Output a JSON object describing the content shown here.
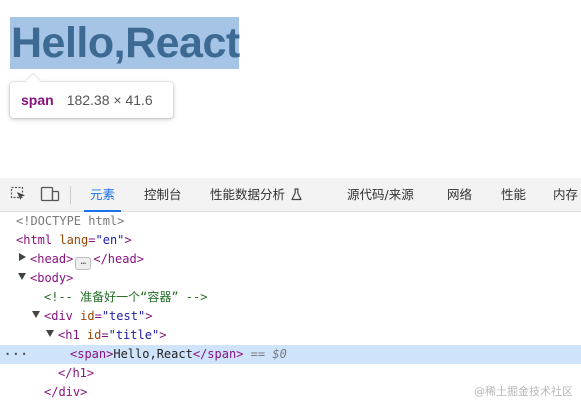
{
  "preview": {
    "heading": "Hello,React",
    "tooltip": {
      "tag": "span",
      "size": "182.38 × 41.6"
    }
  },
  "devtools": {
    "tabs": [
      {
        "label": "元素",
        "active": true
      },
      {
        "label": "控制台"
      },
      {
        "label": "性能数据分析"
      },
      {
        "label": "源代码/来源"
      },
      {
        "label": "网络"
      },
      {
        "label": "性能"
      },
      {
        "label": "内存"
      }
    ],
    "accent_color": "#1a73e8",
    "dom": {
      "doctype": "<!DOCTYPE html>",
      "html_open": "<html",
      "html_lang_attr": "lang",
      "html_lang_val": "\"en\"",
      "html_close_bracket": ">",
      "head_open": "<head>",
      "head_ellipsis": "…",
      "head_close": "</head>",
      "body_open": "<body>",
      "comment": "<!-- 准备好一个“容器” -->",
      "div_open": "<div",
      "div_id_attr": "id",
      "div_id_val": "\"test\"",
      "div_close_bracket": ">",
      "h1_open": "<h1",
      "h1_id_attr": "id",
      "h1_id_val": "\"title\"",
      "h1_close_bracket": ">",
      "span_open": "<span>",
      "span_text": "Hello,React",
      "span_close": "</span>",
      "selected_eq": "== ",
      "selected_ref": "$0",
      "row_dots": "···",
      "h1_close": "</h1>",
      "div_close": "</div>"
    },
    "watermark": "@稀土掘金技术社区"
  }
}
